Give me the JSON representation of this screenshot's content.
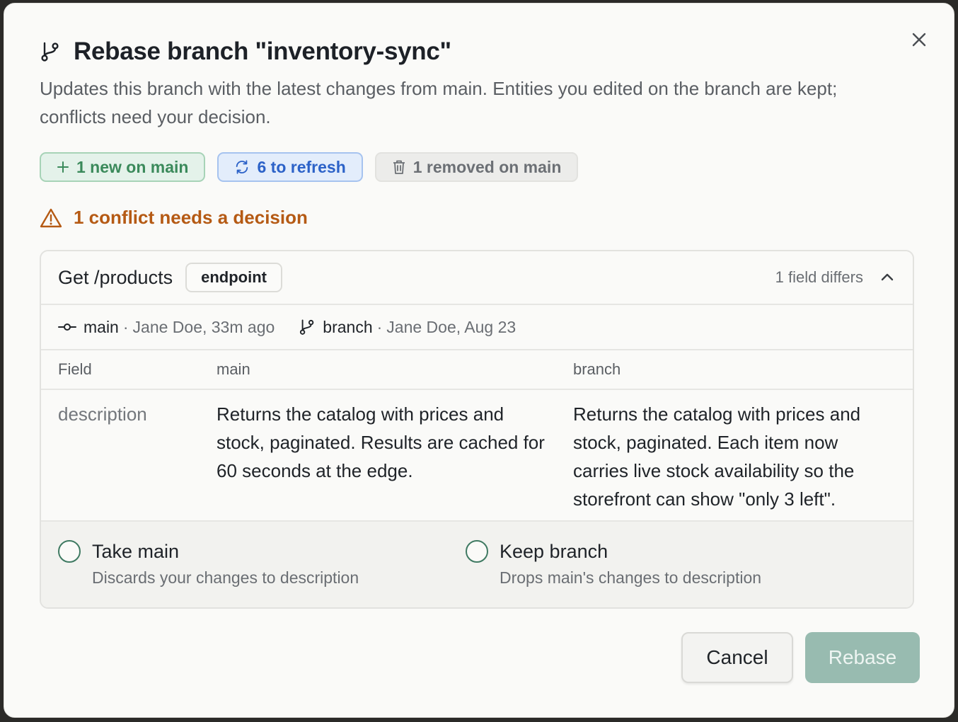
{
  "dialog": {
    "title": "Rebase branch \"inventory-sync\"",
    "subtitle": "Updates this branch with the latest changes from main. Entities you edited on the branch are kept; conflicts need your decision.",
    "close_icon": "close-icon",
    "title_icon": "git-branch-icon"
  },
  "chips": {
    "new_label": "1 new on main",
    "refresh_label": "6 to refresh",
    "removed_label": "1 removed on main"
  },
  "conflict": {
    "label": "1 conflict needs a decision",
    "icon": "warning-icon"
  },
  "entity": {
    "name": "Get /products",
    "type_badge": "endpoint",
    "diff_count": "1 field differs",
    "main_ref": "main",
    "main_meta": "Jane Doe, 33m ago",
    "branch_ref": "branch",
    "branch_meta": "Jane Doe, Aug 23",
    "table": {
      "headers": {
        "field": "Field",
        "main": "main",
        "branch": "branch"
      },
      "rows": [
        {
          "field": "description",
          "main": "Returns the catalog with prices and stock, paginated. Results are cached for 60 seconds at the edge.",
          "branch": "Returns the catalog with prices and stock, paginated. Each item now carries live stock availability so the storefront can show \"only 3 left\"."
        }
      ]
    },
    "choices": {
      "take_main_label": "Take main",
      "take_main_desc": "Discards your changes to description",
      "keep_branch_label": "Keep branch",
      "keep_branch_desc": "Drops main's changes to description"
    }
  },
  "footer": {
    "cancel_label": "Cancel",
    "rebase_label": "Rebase"
  },
  "colors": {
    "accent": "#3f7a62",
    "warning": "#b55a14",
    "new_chip": "#3b8a5b",
    "refresh_chip": "#2c62c8",
    "rebase_disabled": "#98bbb0"
  }
}
